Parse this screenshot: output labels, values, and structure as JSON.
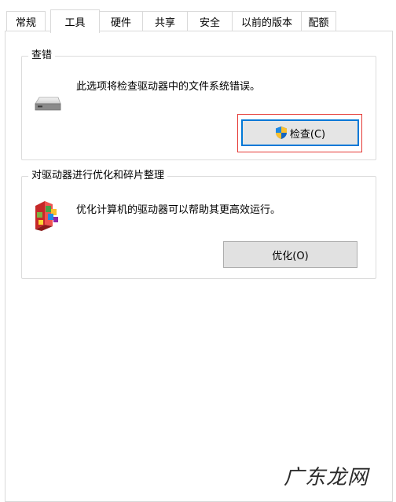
{
  "tabs": [
    {
      "label": "常规"
    },
    {
      "label": "工具",
      "active": true
    },
    {
      "label": "硬件"
    },
    {
      "label": "共享"
    },
    {
      "label": "安全"
    },
    {
      "label": "以前的版本"
    },
    {
      "label": "配额"
    }
  ],
  "error_check": {
    "title": "查错",
    "description": "此选项将检查驱动器中的文件系统错误。",
    "button_label": "检查(C)",
    "icon": "drive-icon",
    "button_icon": "uac-shield-icon"
  },
  "optimize": {
    "title": "对驱动器进行优化和碎片整理",
    "description": "优化计算机的驱动器可以帮助其更高效运行。",
    "button_label": "优化(O)",
    "icon": "defrag-icon"
  },
  "watermark": "广东龙网",
  "colors": {
    "highlight": "#e53935",
    "focus_border": "#0078d7"
  }
}
